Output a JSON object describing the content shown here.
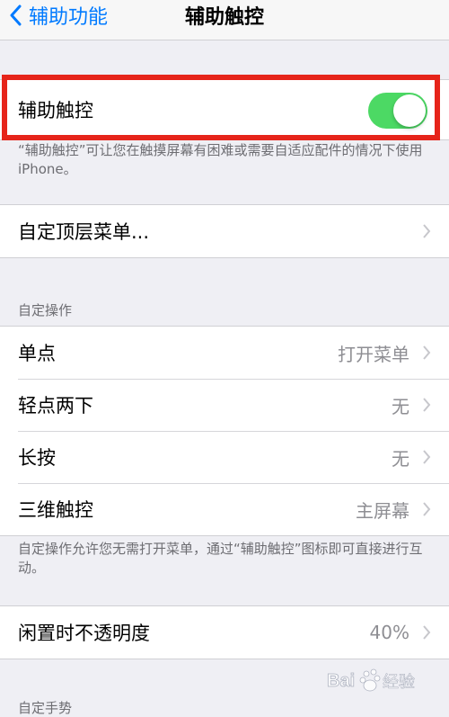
{
  "nav": {
    "back_label": "辅助功能",
    "title": "辅助触控"
  },
  "main_toggle": {
    "label": "辅助触控",
    "state": "on",
    "color": "#4cd964"
  },
  "main_note": "“辅助触控”可让您在触摸屏幕有困难或需要自适应配件的情况下使用 iPhone。",
  "top_menu": {
    "label": "自定顶层菜单..."
  },
  "custom_actions": {
    "header": "自定操作",
    "rows": [
      {
        "label": "单点",
        "value": "打开菜单"
      },
      {
        "label": "轻点两下",
        "value": "无"
      },
      {
        "label": "长按",
        "value": "无"
      },
      {
        "label": "三维触控",
        "value": "主屏幕"
      }
    ],
    "note": "自定操作允许您无需打开菜单，通过“辅助触控”图标即可直接进行互动。"
  },
  "idle_opacity": {
    "label": "闲置时不透明度",
    "value": "40%"
  },
  "gestures_header": "自定手势",
  "highlight_color": "#e6241a",
  "watermark": {
    "text": "Bai经验",
    "brand": "Baidu jingyan"
  }
}
